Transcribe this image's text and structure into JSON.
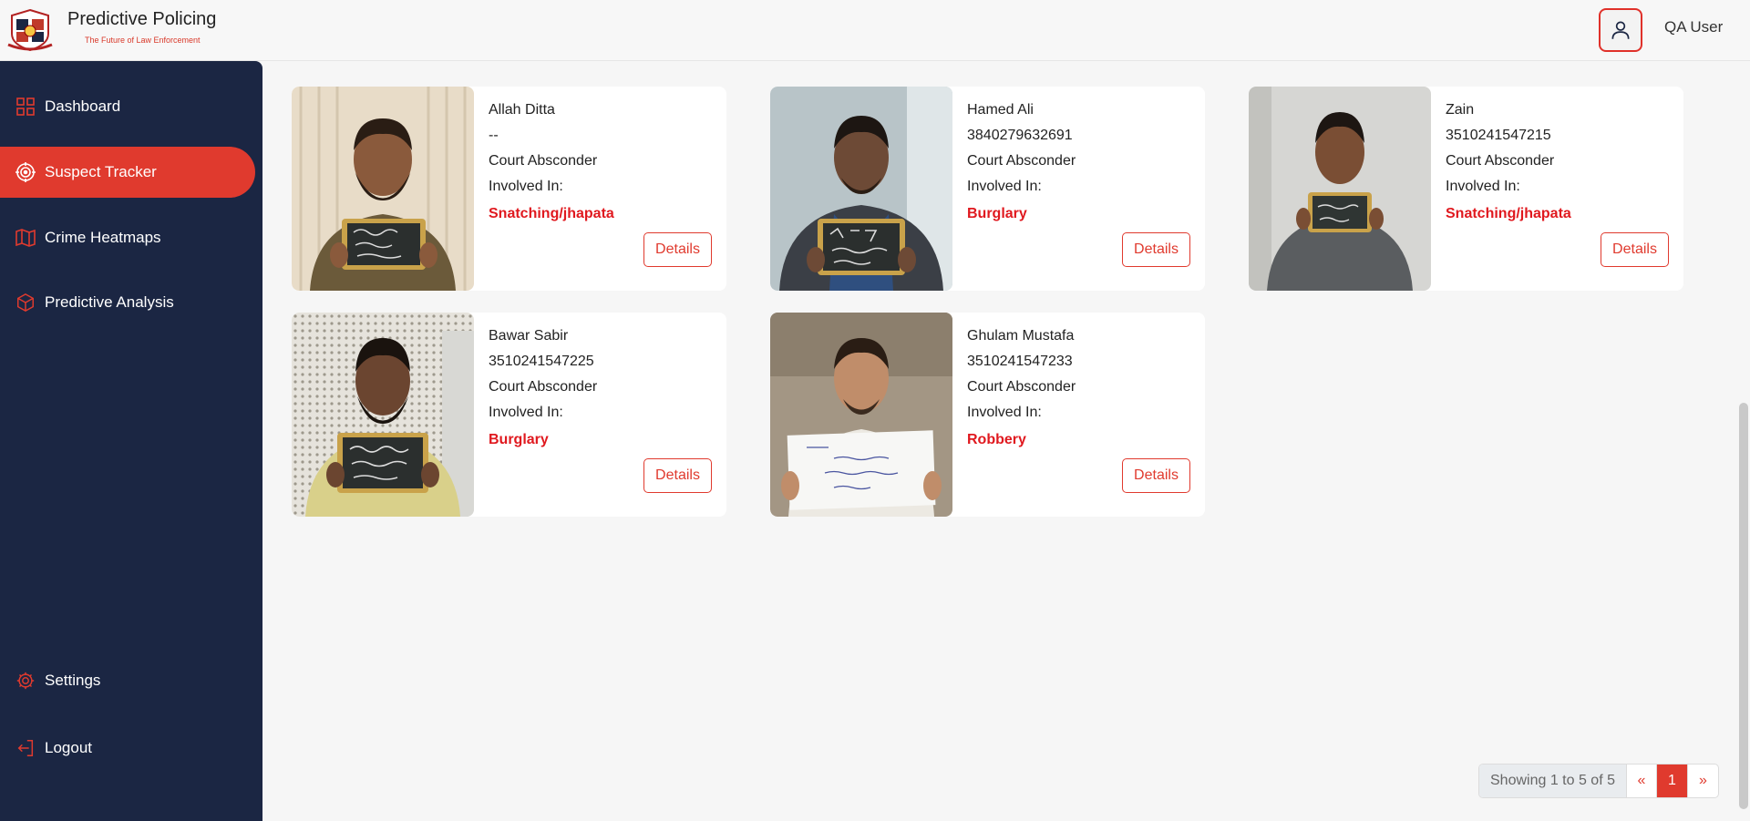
{
  "header": {
    "app_title": "Predictive Policing",
    "app_subtitle": "The Future of Law Enforcement",
    "user_name": "QA User"
  },
  "sidebar": {
    "items": [
      {
        "label": "Dashboard",
        "icon": "grid-icon"
      },
      {
        "label": "Suspect Tracker",
        "icon": "target-icon",
        "active": true
      },
      {
        "label": "Crime Heatmaps",
        "icon": "map-icon"
      },
      {
        "label": "Predictive Analysis",
        "icon": "cube-icon"
      }
    ],
    "bottom": [
      {
        "label": "Settings",
        "icon": "gear-icon"
      },
      {
        "label": "Logout",
        "icon": "logout-icon"
      }
    ]
  },
  "suspects": [
    {
      "name": "Allah Ditta",
      "id": "--",
      "status": "Court Absconder",
      "involved_label": "Involved In:",
      "crime": "Snatching/jhapata",
      "details_label": "Details"
    },
    {
      "name": "Hamed Ali",
      "id": "3840279632691",
      "status": "Court Absconder",
      "involved_label": "Involved In:",
      "crime": "Burglary",
      "details_label": "Details"
    },
    {
      "name": "Zain",
      "id": "3510241547215",
      "status": "Court Absconder",
      "involved_label": "Involved In:",
      "crime": "Snatching/jhapata",
      "details_label": "Details"
    },
    {
      "name": "Bawar Sabir",
      "id": "3510241547225",
      "status": "Court Absconder",
      "involved_label": "Involved In:",
      "crime": "Burglary",
      "details_label": "Details"
    },
    {
      "name": "Ghulam Mustafa",
      "id": "3510241547233",
      "status": "Court Absconder",
      "involved_label": "Involved In:",
      "crime": "Robbery",
      "details_label": "Details"
    }
  ],
  "pagination": {
    "showing": "Showing 1 to 5 of 5",
    "prev": "«",
    "current": "1",
    "next": "»"
  },
  "colors": {
    "accent": "#e03a2e",
    "sidebar_bg": "#1b2643",
    "crime_text": "#e0191f"
  }
}
